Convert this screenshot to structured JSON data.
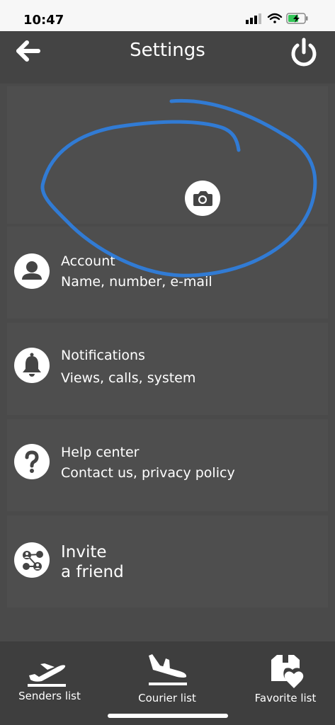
{
  "status": {
    "time": "10:47"
  },
  "header": {
    "title": "Settings"
  },
  "menu": [
    {
      "title": "Account",
      "subtitle": "Name, number, e-mail",
      "icon": "user-icon"
    },
    {
      "title": "Notifications",
      "subtitle": "Views, calls, system",
      "icon": "bell-icon"
    },
    {
      "title": "Help center",
      "subtitle": "Contact us, privacy policy",
      "icon": "question-icon"
    },
    {
      "title": "Invite",
      "subtitle": "a friend",
      "icon": "share-users-icon"
    }
  ],
  "tabs": [
    {
      "label": "Senders list",
      "icon": "plane-takeoff-icon"
    },
    {
      "label": "Courier list",
      "icon": "plane-landing-icon"
    },
    {
      "label": "Favorite list",
      "icon": "gift-heart-icon"
    }
  ],
  "colors": {
    "background": "#4a4a4a",
    "card": "#4e4e4e",
    "annotation": "#2f7fe0"
  }
}
